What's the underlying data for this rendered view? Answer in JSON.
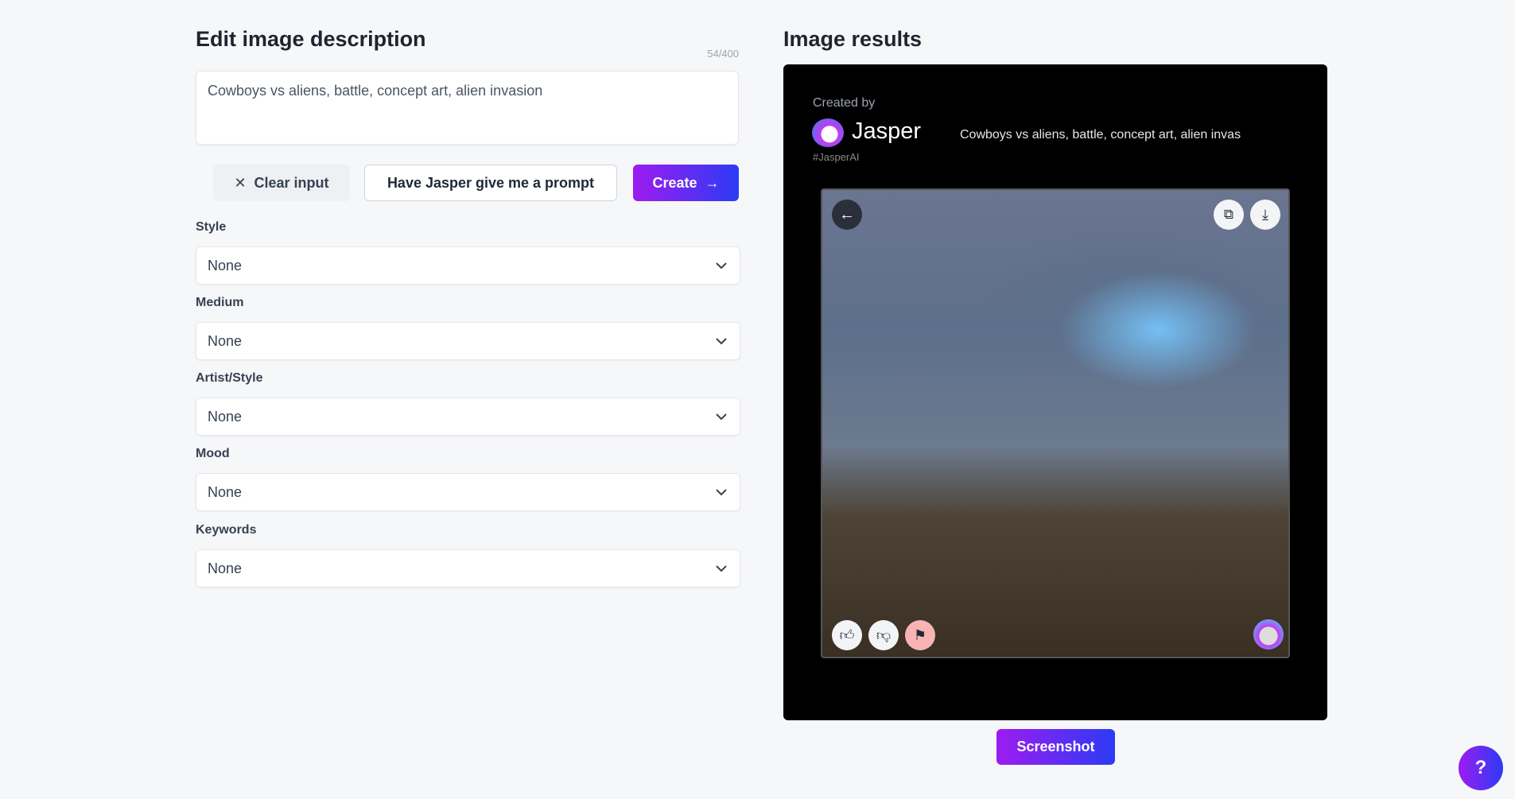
{
  "editor": {
    "title": "Edit image description",
    "counter": "54/400",
    "description": "Cowboys vs aliens, battle, concept art, alien invasion",
    "clear_label": "Clear input",
    "prompt_label": "Have Jasper give me a prompt",
    "create_label": "Create",
    "fields": [
      {
        "label": "Style",
        "value": "None"
      },
      {
        "label": "Medium",
        "value": "None"
      },
      {
        "label": "Artist/Style",
        "value": "None"
      },
      {
        "label": "Mood",
        "value": "None"
      },
      {
        "label": "Keywords",
        "value": "None"
      }
    ]
  },
  "results": {
    "title": "Image results",
    "created_by": "Created by",
    "brand": "Jasper",
    "hashtag": "#JasperAI",
    "prompt": "Cowboys vs aliens, battle, concept art, alien invas"
  },
  "screenshot_label": "Screenshot",
  "help_label": "?",
  "colors": {
    "gradient_start": "#9d1cf0",
    "gradient_end": "#2c3bf5",
    "flag_bg": "#f8b4b4"
  }
}
